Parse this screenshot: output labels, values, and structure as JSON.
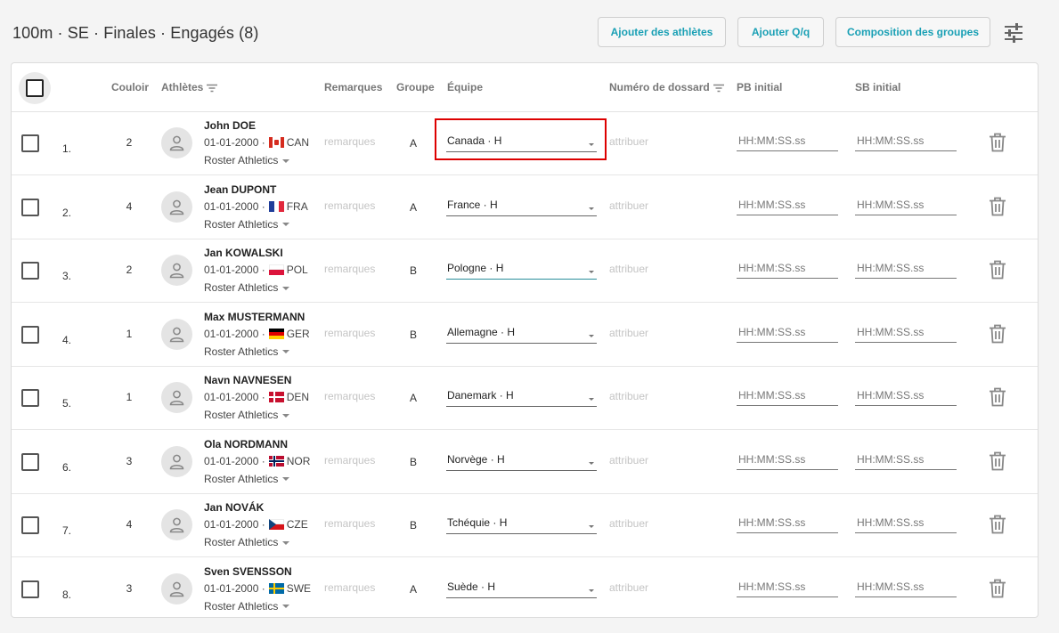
{
  "header": {
    "title": "100m · SE · Finales · Engagés (8)",
    "buttons": {
      "add_athletes": "Ajouter des athlètes",
      "add_qq": "Ajouter Q/q",
      "group_composition": "Composition des groupes"
    }
  },
  "table": {
    "columns": {
      "lane": "Couloir",
      "athletes": "Athlètes",
      "remarks": "Remarques",
      "group": "Groupe",
      "team": "Équipe",
      "bib": "Numéro de dossard",
      "pb": "PB initial",
      "sb": "SB initial"
    },
    "placeholders": {
      "remarks": "remarques",
      "bib": "attribuer",
      "time": "HH:MM:SS.ss"
    },
    "rows": [
      {
        "index": "1.",
        "lane": "2",
        "name": "John DOE",
        "dob": "01-01-2000 ·",
        "country": "CAN",
        "flag": "can",
        "roster": "Roster Athletics",
        "group": "A",
        "team": "Canada · H"
      },
      {
        "index": "2.",
        "lane": "4",
        "name": "Jean DUPONT",
        "dob": "01-01-2000 ·",
        "country": "FRA",
        "flag": "fra",
        "roster": "Roster Athletics",
        "group": "A",
        "team": "France · H"
      },
      {
        "index": "3.",
        "lane": "2",
        "name": "Jan KOWALSKI",
        "dob": "01-01-2000 ·",
        "country": "POL",
        "flag": "pol",
        "roster": "Roster Athletics",
        "group": "B",
        "team": "Pologne · H"
      },
      {
        "index": "4.",
        "lane": "1",
        "name": "Max MUSTERMANN",
        "dob": "01-01-2000 ·",
        "country": "GER",
        "flag": "ger",
        "roster": "Roster Athletics",
        "group": "B",
        "team": "Allemagne · H"
      },
      {
        "index": "5.",
        "lane": "1",
        "name": "Navn NAVNESEN",
        "dob": "01-01-2000 ·",
        "country": "DEN",
        "flag": "den",
        "roster": "Roster Athletics",
        "group": "A",
        "team": "Danemark · H"
      },
      {
        "index": "6.",
        "lane": "3",
        "name": "Ola NORDMANN",
        "dob": "01-01-2000 ·",
        "country": "NOR",
        "flag": "nor",
        "roster": "Roster Athletics",
        "group": "B",
        "team": "Norvège · H"
      },
      {
        "index": "7.",
        "lane": "4",
        "name": "Jan NOVÁK",
        "dob": "01-01-2000 ·",
        "country": "CZE",
        "flag": "cze",
        "roster": "Roster Athletics",
        "group": "B",
        "team": "Tchéquie · H"
      },
      {
        "index": "8.",
        "lane": "3",
        "name": "Sven SVENSSON",
        "dob": "01-01-2000 ·",
        "country": "SWE",
        "flag": "swe",
        "roster": "Roster Athletics",
        "group": "A",
        "team": "Suède · H"
      }
    ]
  },
  "colors": {
    "accent": "#1aa0b5",
    "highlight": "#dd0000"
  },
  "icons": {
    "settings": "sliders-icon",
    "delete": "trash-icon",
    "avatar": "person-icon",
    "filter": "filter-icon"
  }
}
